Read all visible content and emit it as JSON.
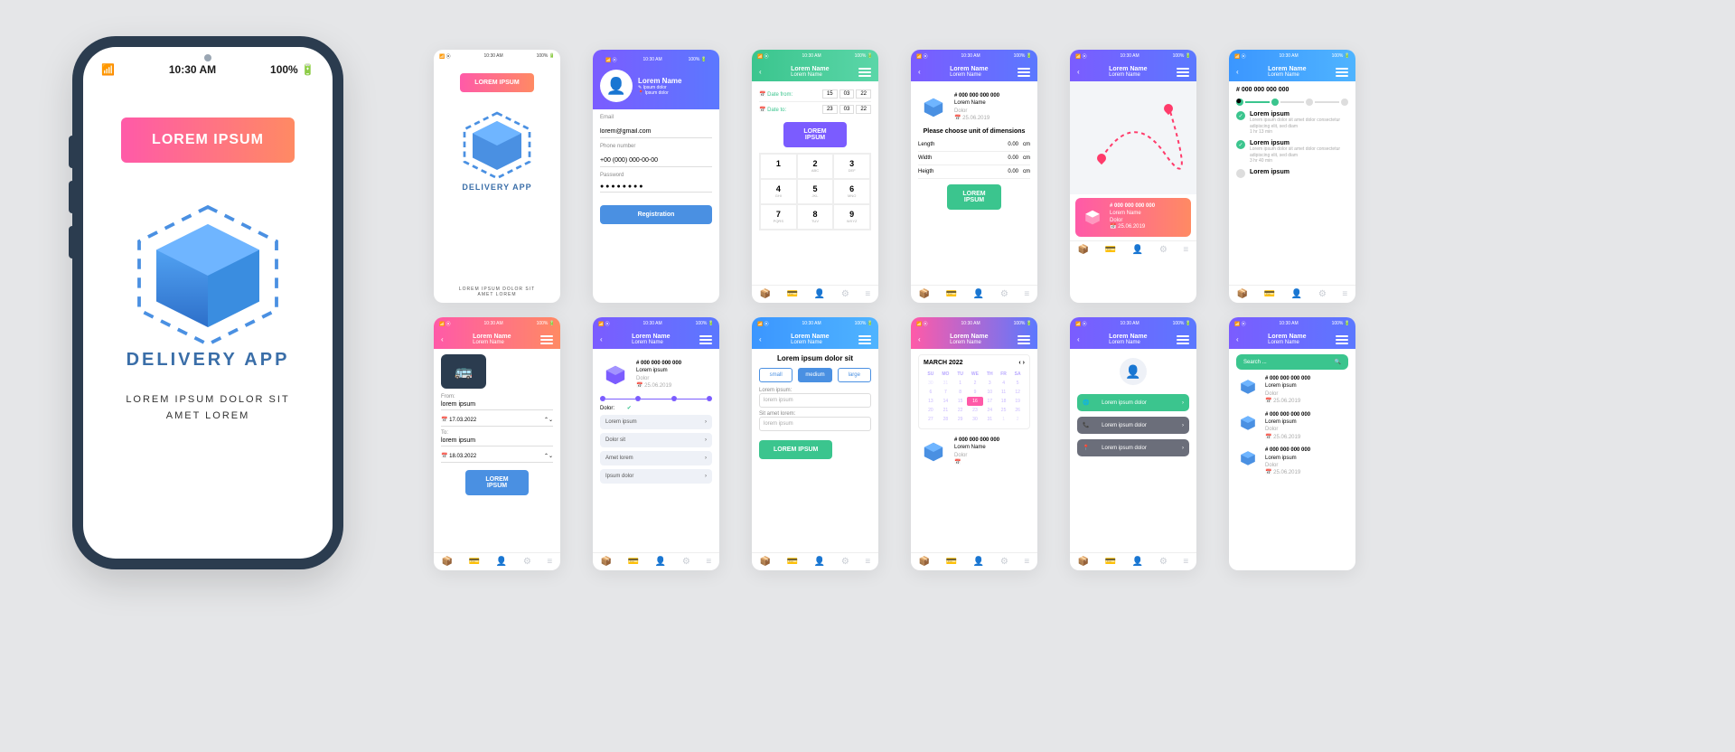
{
  "global": {
    "time": "10:30 AM",
    "battery": "100%",
    "signal": "📶 ⦿"
  },
  "bigphone": {
    "cta": "LOREM IPSUM",
    "app_name": "DELIVERY APP",
    "caption1": "Lorem ipsum dolor sit",
    "caption2": "amet lorem"
  },
  "s1": {
    "btn": "LOREM IPSUM",
    "app_name": "DELIVERY APP",
    "caption1": "Lorem ipsum dolor sit",
    "caption2": "amet lorem"
  },
  "s2": {
    "name": "Lorem Name",
    "sub1": "Ipsum dolor",
    "sub2": "Ipsum dolor",
    "email_lbl": "Email",
    "email": "lorem@gmail.com",
    "phone_lbl": "Phone number",
    "phone": "+00 (000) 000-00-00",
    "pwd_lbl": "Password",
    "pwd": "● ● ● ● ● ● ● ●",
    "btn": "Registration"
  },
  "s3": {
    "title": "Lorem Name",
    "sub": "Lorem Name",
    "from_lbl": "Date from:",
    "to_lbl": "Date to:",
    "from": [
      "15",
      "03",
      "22"
    ],
    "to": [
      "23",
      "03",
      "22"
    ],
    "btn": "LOREM IPSUM",
    "pad": [
      [
        "1",
        ""
      ],
      [
        "2",
        "ABC"
      ],
      [
        "3",
        "DEF"
      ],
      [
        "4",
        "GHI"
      ],
      [
        "5",
        "JKL"
      ],
      [
        "6",
        "MNO"
      ],
      [
        "7",
        "PQRS"
      ],
      [
        "8",
        "TUV"
      ],
      [
        "9",
        "WXYZ"
      ]
    ]
  },
  "s4": {
    "title": "Lorem Name",
    "sub": "Lorem Name",
    "order": "# 000 000 000 000",
    "uname": "Lorem Name",
    "utype": "Dolor",
    "date": "25.06.2019",
    "head": "Please choose unit of dimensions",
    "dim": [
      [
        "Length",
        "0.00",
        "cm"
      ],
      [
        "Width",
        "0.00",
        "cm"
      ],
      [
        "Heigth",
        "0.00",
        "cm"
      ]
    ],
    "btn": "LOREM IPSUM"
  },
  "s5": {
    "title": "Lorem Name",
    "sub": "Lorem Name",
    "card": {
      "order": "# 000 000 000 000",
      "name": "Lorem Name",
      "type": "Dolor",
      "date": "25.06.2019"
    }
  },
  "s6": {
    "title": "Lorem Name",
    "sub": "Lorem Name",
    "order": "# 000 000 000 000",
    "steps": [
      {
        "done": true,
        "h": "Lorem ipsum",
        "p": "Lorem ipsum dolor sit amet dolor consectetur adipiscing elit, sed diam",
        "t": "1 hr  13 min"
      },
      {
        "done": true,
        "h": "Lorem ipsum",
        "p": "Lorem ipsum dolor sit amet dolor consectetur adipiscing elit, sed diam",
        "t": "3 hr  40 min"
      },
      {
        "done": false,
        "h": "Lorem ipsum",
        "p": "",
        "t": ""
      }
    ],
    "prog": [
      true,
      true,
      false,
      false
    ]
  },
  "s7": {
    "title": "Lorem Name",
    "sub": "Lorem Name",
    "from_lbl": "From:",
    "from": "lorem ipsum",
    "to_lbl": "To:",
    "to": "lorem ipsum",
    "d1": "17.03.2022",
    "d2": "18.03.2022",
    "btn": "LOREM IPSUM"
  },
  "s8": {
    "title": "Lorem Name",
    "sub": "Lorem Name",
    "order": "# 000 000 000 000",
    "uname": "Lorem ipsum",
    "utype": "Dolor",
    "date": "25.06.2019",
    "dolor_lbl": "Dolor:",
    "rows": [
      "Lorem ipsum",
      "Dolor sit",
      "Amet lorem",
      "Ipsum dolor"
    ]
  },
  "s9": {
    "title": "Lorem Name",
    "sub": "Lorem Name",
    "heading": "Lorem ipsum dolor sit",
    "sizes": [
      "small",
      "medium",
      "large"
    ],
    "lbl1": "Lorem ipsum:",
    "val1": "lorem ipsum",
    "lbl2": "Sit amet lorem:",
    "val2": "lorem ipsum",
    "btn": "LOREM IPSUM"
  },
  "s10": {
    "title": "Lorem Name",
    "sub": "Lorem Name",
    "month": "MARCH 2022",
    "days": [
      "SU",
      "MO",
      "TU",
      "WE",
      "TH",
      "FR",
      "SA"
    ],
    "grid": [
      [
        "30",
        "31",
        "1",
        "2",
        "3",
        "4",
        "5"
      ],
      [
        "6",
        "7",
        "8",
        "9",
        "10",
        "11",
        "12"
      ],
      [
        "13",
        "14",
        "15",
        "16",
        "17",
        "18",
        "19"
      ],
      [
        "20",
        "21",
        "22",
        "23",
        "24",
        "25",
        "26"
      ],
      [
        "27",
        "28",
        "29",
        "30",
        "31",
        "1",
        "2"
      ]
    ],
    "sel": "16",
    "pkg": {
      "order": "# 000 000 000 000",
      "name": "Lorem Name",
      "type": "Dolor"
    }
  },
  "s11": {
    "title": "Lorem Name",
    "sub": "Lorem Name",
    "items": [
      "Lorem ipsum dolor",
      "Lorem ipsum dolor",
      "Lorem ipsum dolor"
    ]
  },
  "s12": {
    "title": "Lorem Name",
    "sub": "Lorem Name",
    "search": "Search ...",
    "items": [
      {
        "order": "# 000 000 000 000",
        "name": "Lorem ipsum",
        "type": "Dolor",
        "date": "25.06.2019"
      },
      {
        "order": "# 000 000 000 000",
        "name": "Lorem ipsum",
        "type": "Dolor",
        "date": "25.06.2019"
      },
      {
        "order": "# 000 000 000 000",
        "name": "Lorem ipsum",
        "type": "Dolor",
        "date": "25.06.2019"
      }
    ]
  }
}
